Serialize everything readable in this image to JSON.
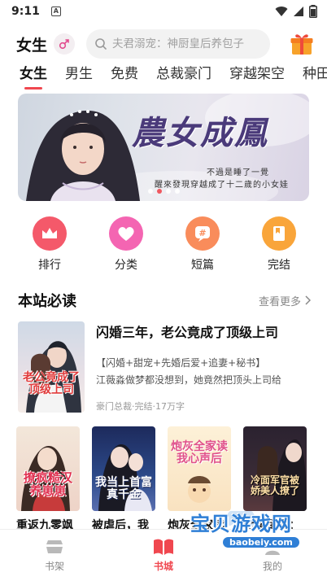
{
  "status": {
    "time": "9:11",
    "notification_badge": "A"
  },
  "header": {
    "gender_title": "女生",
    "search_placeholder": "夫君溺宠：神厨皇后养包子"
  },
  "tabs": [
    "女生",
    "男生",
    "免费",
    "总裁豪门",
    "穿越架空",
    "种田"
  ],
  "banner": {
    "title": "農女成鳳",
    "line1": "不過是睡了一覺",
    "line2": "醒來發現穿越成了十二歲的小女娃",
    "active_dot": 1,
    "dot_count": 4
  },
  "quick_entries": [
    {
      "label": "排行",
      "icon": "crown-icon",
      "color": "#f4596a"
    },
    {
      "label": "分类",
      "icon": "heart-icon",
      "color": "#f465b2"
    },
    {
      "label": "短篇",
      "icon": "hash-icon",
      "color": "#f98c5b"
    },
    {
      "label": "完结",
      "icon": "book-check-icon",
      "color": "#f9a53a"
    }
  ],
  "section": {
    "title": "本站必读",
    "more": "查看更多"
  },
  "featured": {
    "title": "闪婚三年，老公竟成了顶级上司",
    "tags": "【闪婚+甜宠+先婚后爱+追妻+秘书】",
    "desc": "江薇淼做梦都没想到，她竟然把顶头上司给",
    "meta": "豪门总裁·完结·17万字",
    "cover_text": "老公竟成了顶级上司"
  },
  "books": [
    {
      "title": "重返九零飒",
      "cover_text": "撩疯糙汉养崽崽"
    },
    {
      "title": "被虐后，我",
      "cover_text": "我当上首富真千金"
    },
    {
      "title": "炮灰全家读",
      "cover_text": "炮灰全家读我心声后"
    },
    {
      "title": "七零军婚：",
      "cover_text": "冷面军官被娇美人撩了"
    }
  ],
  "bottom_nav": [
    {
      "label": "书架",
      "icon": "bookshelf-icon"
    },
    {
      "label": "书城",
      "icon": "book-open-icon"
    },
    {
      "label": "我的",
      "icon": "person-icon"
    }
  ],
  "watermark": {
    "main": "宝贝游戏网",
    "sub": "baobeiy.com"
  },
  "colors": {
    "accent": "#f0474f",
    "text": "#222222",
    "muted": "#888888"
  }
}
